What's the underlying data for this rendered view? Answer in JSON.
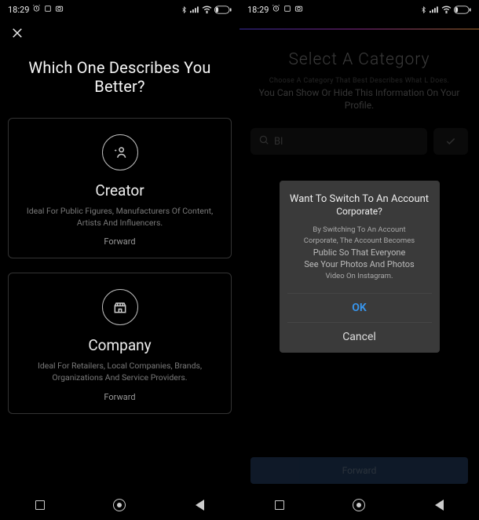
{
  "status": {
    "time": "18:29",
    "battery": "18"
  },
  "left": {
    "heading": "Which One Describes You Better?",
    "cards": [
      {
        "title": "Creator",
        "desc": "Ideal For Public Figures, Manufacturers Of Content, Artists And Influencers.",
        "forward": "Forward"
      },
      {
        "title": "Company",
        "desc": "Ideal For Retailers, Local Companies, Brands, Organizations And Service Providers.",
        "forward": "Forward"
      }
    ]
  },
  "right": {
    "title": "Select A Category",
    "sub1": "Choose A Category That Best Describes What L Does.",
    "sub2": "You Can Show Or Hide This Information On Your Profile.",
    "searchText": "Bl",
    "dialog": {
      "title": "Want To Switch To An Account",
      "title2": "Corporate?",
      "body1": "By Switching To An Account",
      "body2": "Corporate, The Account Becomes",
      "body3": "Public So That Everyone",
      "body4": "See Your Photos And Photos",
      "body5": "Video On Instagram.",
      "ok": "OK",
      "cancel": "Cancel"
    },
    "forward": "Forward"
  }
}
